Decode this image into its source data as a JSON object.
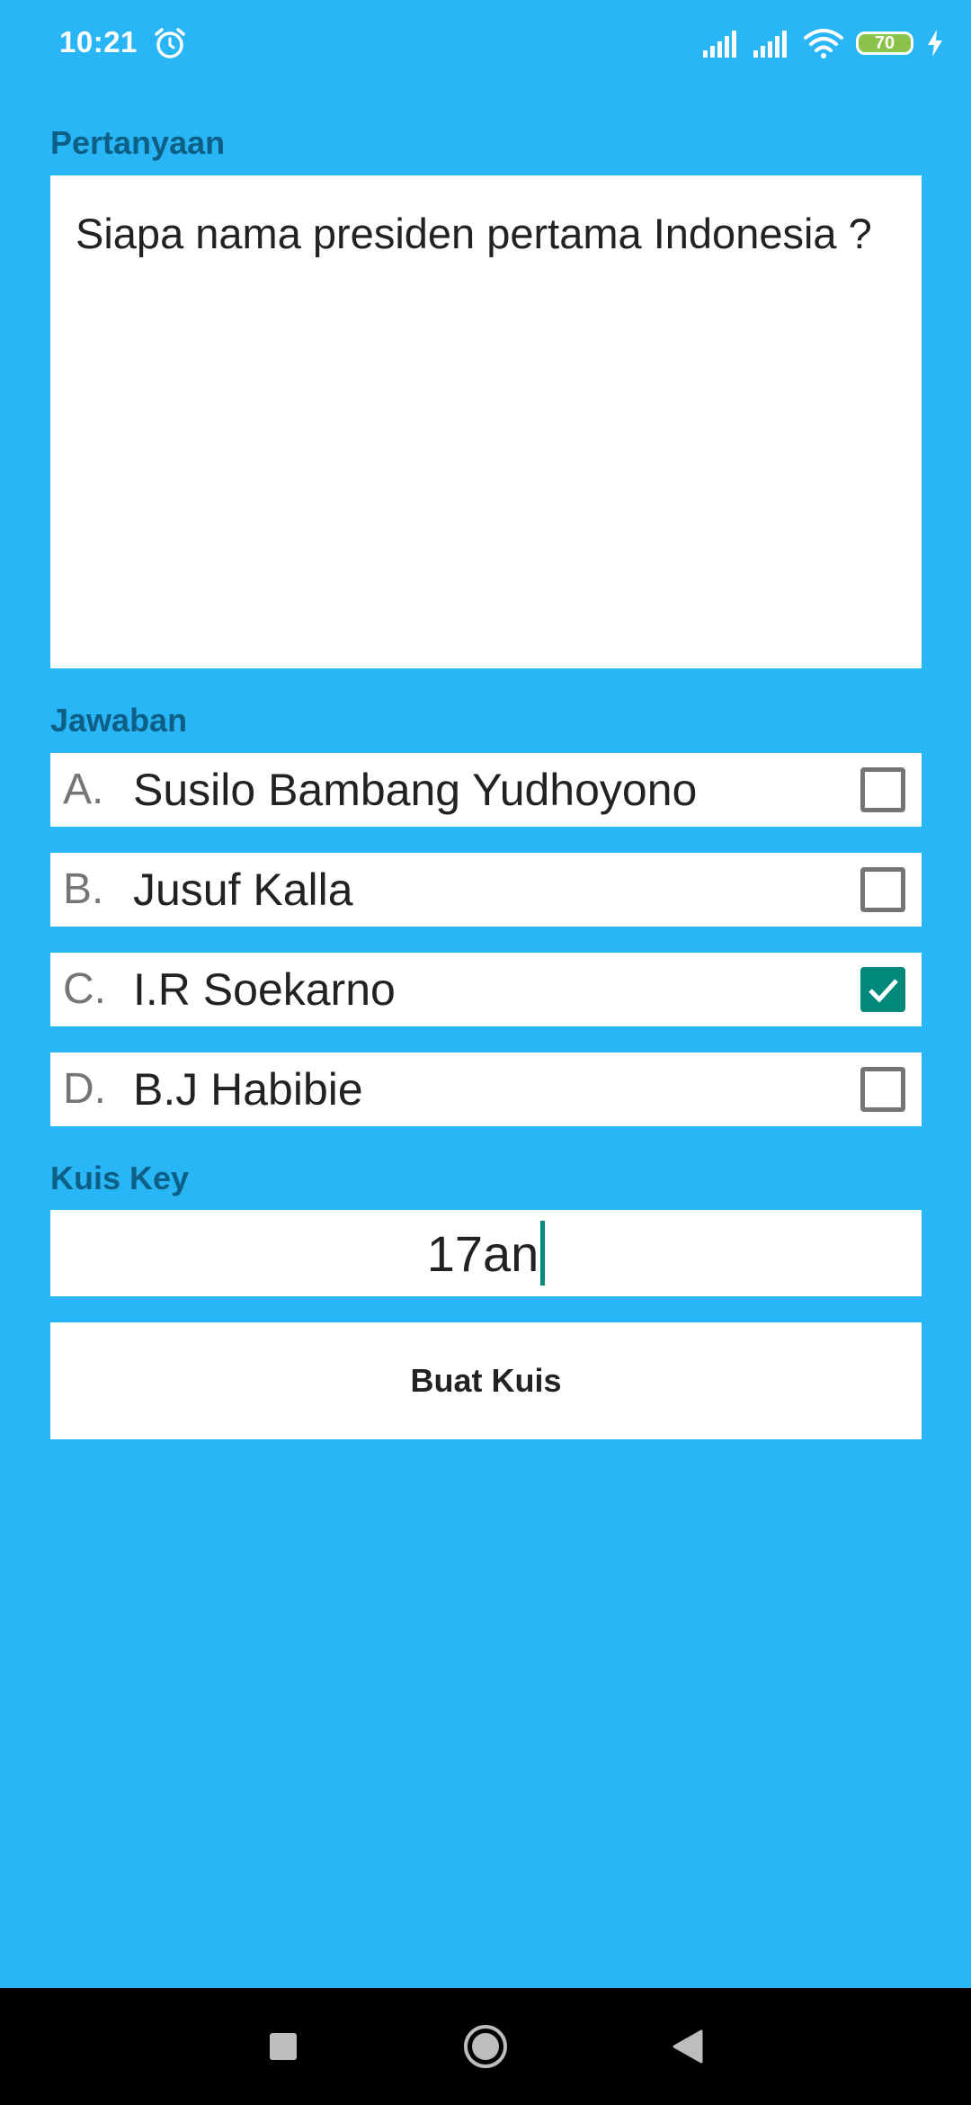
{
  "status_bar": {
    "time": "10:21",
    "battery_level": "70",
    "icons": [
      "alarm-icon",
      "cellular-signal-icon",
      "cellular-signal-icon",
      "wifi-icon",
      "battery-icon",
      "charging-bolt-icon"
    ]
  },
  "question": {
    "label": "Pertanyaan",
    "value": "Siapa nama presiden pertama Indonesia ?"
  },
  "answers": {
    "label": "Jawaban",
    "items": [
      {
        "letter": "A.",
        "text": "Susilo Bambang Yudhoyono",
        "checked": false
      },
      {
        "letter": "B.",
        "text": "Jusuf Kalla",
        "checked": false
      },
      {
        "letter": "C.",
        "text": "I.R Soekarno",
        "checked": true
      },
      {
        "letter": "D.",
        "text": "B.J Habibie",
        "checked": false
      }
    ]
  },
  "quiz_key": {
    "label": "Kuis Key",
    "value": "17an"
  },
  "submit": {
    "label": "Buat Kuis"
  },
  "nav_bar": {
    "icons": [
      "recents-square-icon",
      "home-circle-icon",
      "back-triangle-icon"
    ]
  },
  "colors": {
    "background": "#29b6f6",
    "label": "#0d5f86",
    "accent": "#00897b",
    "charging": "#8bc34a"
  }
}
